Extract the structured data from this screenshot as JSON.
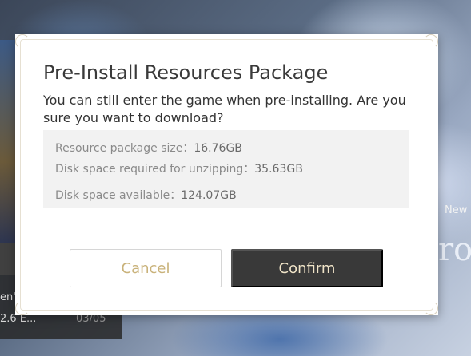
{
  "background": {
    "left_card_line1": "en\"",
    "left_card_line2": "2.6 E...",
    "left_card_date": "03/05",
    "new_label": "New",
    "partial_title": "ro"
  },
  "dialog": {
    "title": "Pre-Install Resources Package",
    "message": "You can still enter the game when pre-installing. Are you sure you want to download?",
    "info": [
      {
        "label": "Resource package size：",
        "value": "16.76GB"
      },
      {
        "label": "Disk space required for unzipping：",
        "value": "35.63GB"
      },
      {
        "label": "Disk space available：",
        "value": "124.07GB"
      }
    ],
    "cancel_label": "Cancel",
    "confirm_label": "Confirm"
  },
  "colors": {
    "confirm_bg": "#393939",
    "confirm_text": "#f0e4c8",
    "cancel_text": "#c9b27a"
  }
}
